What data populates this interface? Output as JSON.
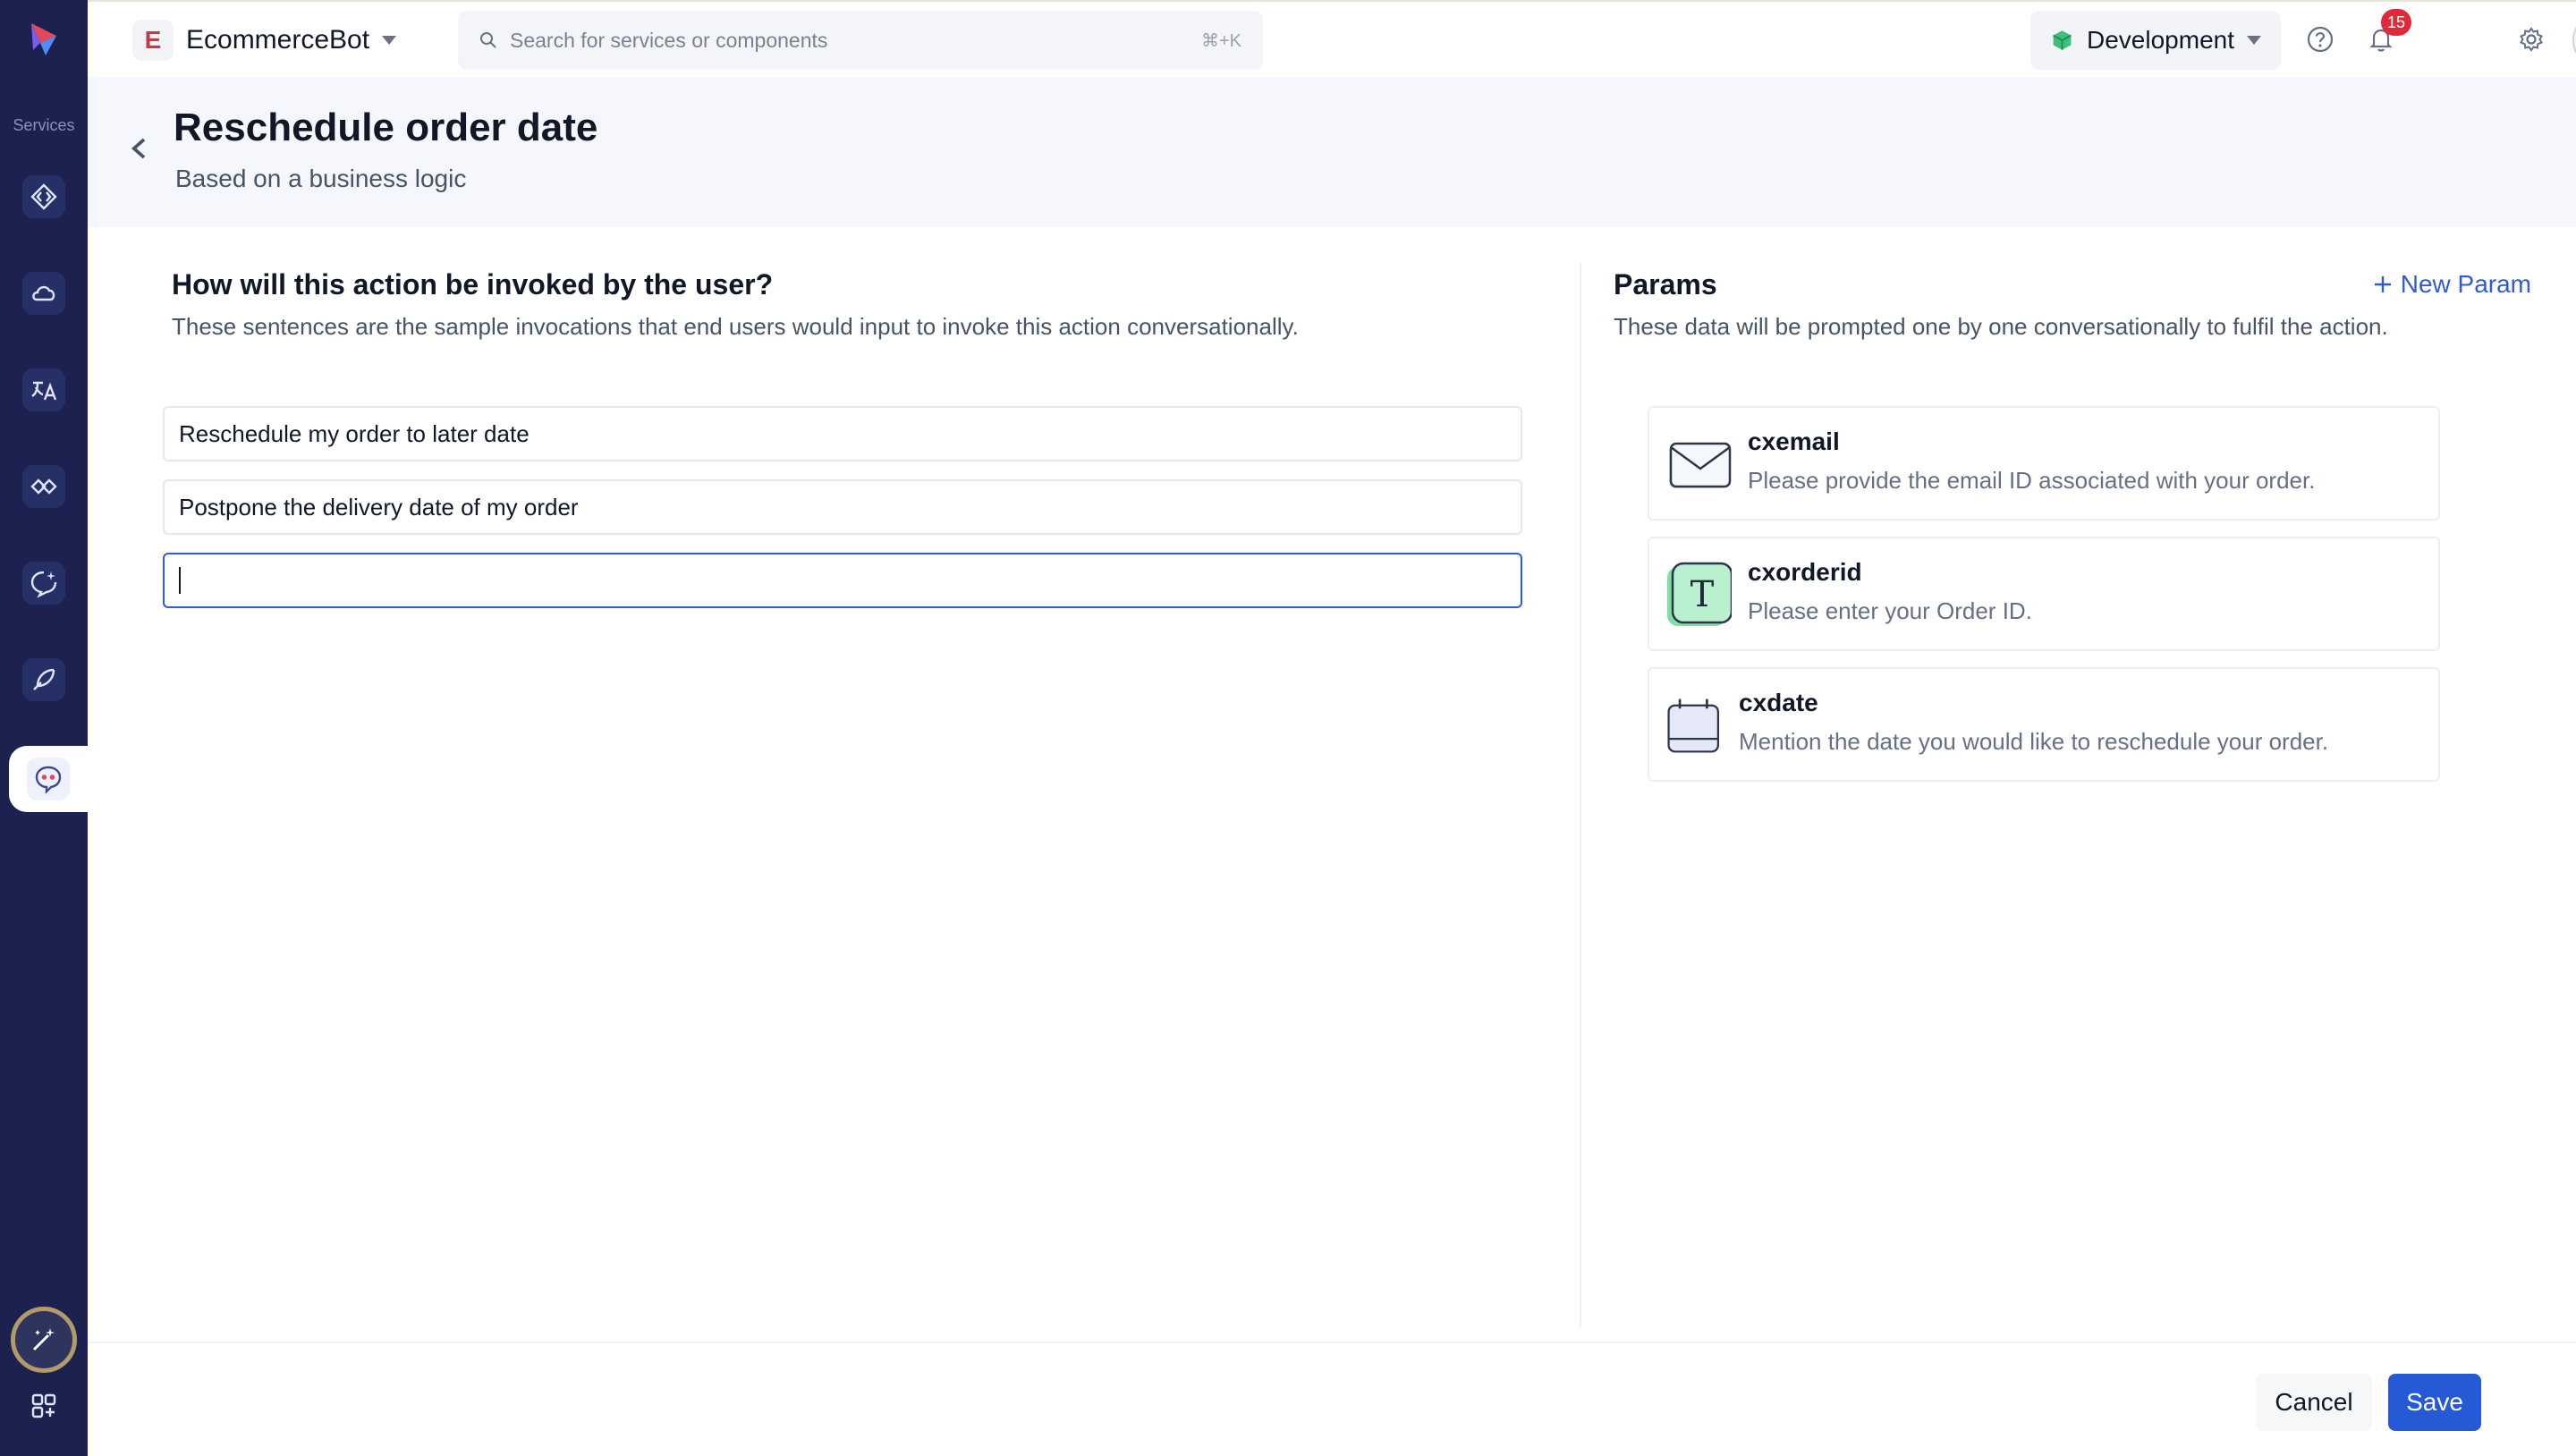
{
  "sidebar": {
    "services_label": "Services",
    "items": [
      {
        "icon": "code-diamond-icon"
      },
      {
        "icon": "cloud-icon"
      },
      {
        "icon": "translate-icon"
      },
      {
        "icon": "integration-icon"
      },
      {
        "icon": "chat-sparkle-icon"
      },
      {
        "icon": "rocket-icon"
      },
      {
        "icon": "bot-chat-icon",
        "active": true
      }
    ],
    "bottom": [
      {
        "icon": "magic-wand-icon"
      },
      {
        "icon": "apps-grid-icon"
      }
    ]
  },
  "topbar": {
    "bot_initial": "E",
    "bot_name": "EcommerceBot",
    "search_placeholder": "Search for services or components",
    "search_shortcut": "⌘+K",
    "environment": "Development",
    "notification_count": "15"
  },
  "header": {
    "title": "Reschedule order date",
    "subtitle": "Based on a business logic"
  },
  "invocation": {
    "title": "How will this action be invoked by the user?",
    "description": "These sentences are the sample invocations that end users would input to invoke this action conversationally.",
    "utterances": [
      "Reschedule my order to later date",
      "Postpone the delivery date of my order",
      ""
    ]
  },
  "params": {
    "title": "Params",
    "new_param_label": "New Param",
    "description": "These data will be prompted one by one conversationally to fulfil the action.",
    "items": [
      {
        "name": "cxemail",
        "prompt": "Please provide the email ID associated with your order.",
        "icon": "email-icon"
      },
      {
        "name": "cxorderid",
        "prompt": "Please enter your Order ID.",
        "icon": "text-icon"
      },
      {
        "name": "cxdate",
        "prompt": "Mention the date you would like to reschedule your order.",
        "icon": "calendar-icon"
      }
    ]
  },
  "footer": {
    "cancel_label": "Cancel",
    "save_label": "Save"
  },
  "colors": {
    "sidebar": "#1c2150",
    "accent": "#2559d6",
    "badge": "#e0293b"
  }
}
